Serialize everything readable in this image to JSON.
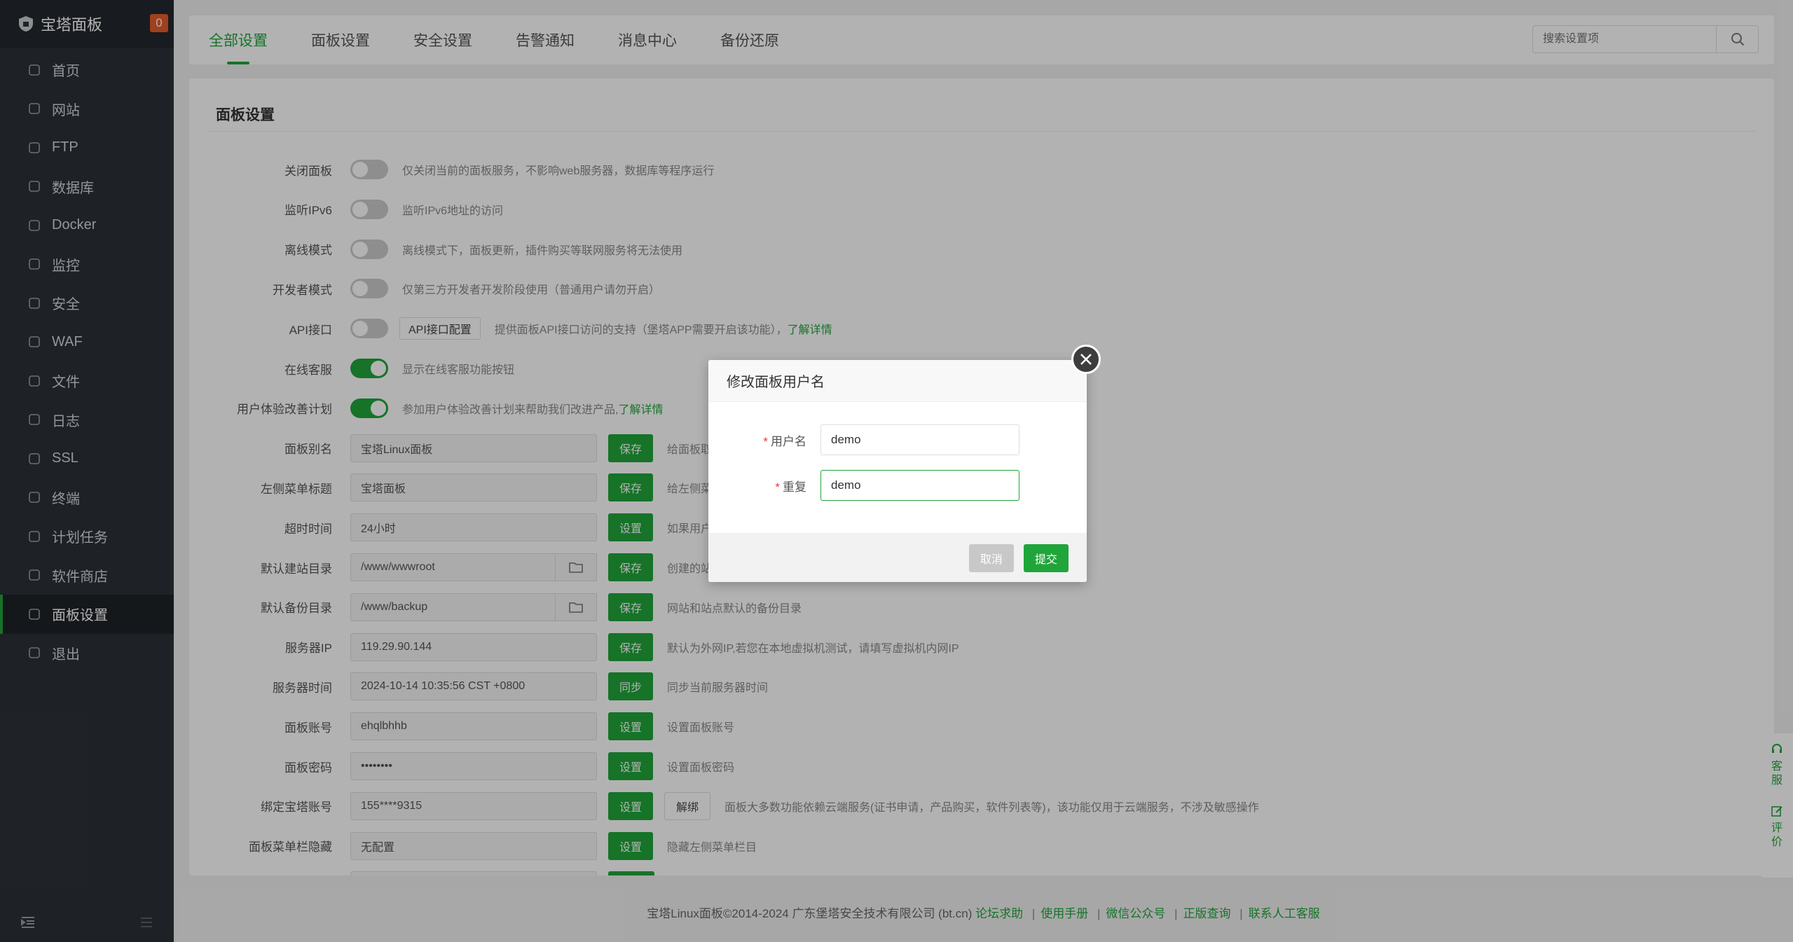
{
  "sidebar": {
    "brand": "宝塔面板",
    "badge": "0",
    "items": [
      {
        "label": "首页",
        "icon": "home-icon"
      },
      {
        "label": "网站",
        "icon": "globe-icon"
      },
      {
        "label": "FTP",
        "icon": "ftp-icon"
      },
      {
        "label": "数据库",
        "icon": "database-icon"
      },
      {
        "label": "Docker",
        "icon": "docker-icon"
      },
      {
        "label": "监控",
        "icon": "monitor-icon"
      },
      {
        "label": "安全",
        "icon": "shield-icon"
      },
      {
        "label": "WAF",
        "icon": "waf-shield-icon"
      },
      {
        "label": "文件",
        "icon": "folder-icon"
      },
      {
        "label": "日志",
        "icon": "log-icon"
      },
      {
        "label": "SSL",
        "icon": "ssl-icon"
      },
      {
        "label": "终端",
        "icon": "terminal-icon"
      },
      {
        "label": "计划任务",
        "icon": "cron-icon"
      },
      {
        "label": "软件商店",
        "icon": "store-icon"
      },
      {
        "label": "面板设置",
        "icon": "gear-icon"
      },
      {
        "label": "退出",
        "icon": "logout-icon"
      }
    ],
    "active_index": 14
  },
  "tabs": [
    "全部设置",
    "面板设置",
    "安全设置",
    "告警通知",
    "消息中心",
    "备份还原"
  ],
  "search": {
    "placeholder": "搜索设置项"
  },
  "panel": {
    "title": "面板设置",
    "toggles": [
      {
        "label": "关闭面板",
        "on": false,
        "desc": "仅关闭当前的面板服务，不影响web服务器，数据库等程序运行"
      },
      {
        "label": "监听IPv6",
        "on": false,
        "desc": "监听IPv6地址的访问"
      },
      {
        "label": "离线模式",
        "on": false,
        "desc": "离线模式下，面板更新，插件购买等联网服务将无法使用"
      },
      {
        "label": "开发者模式",
        "on": false,
        "desc": "仅第三方开发者开发阶段使用（普通用户请勿开启）"
      },
      {
        "label": "API接口",
        "on": false,
        "button": "API接口配置",
        "desc": "提供面板API接口访问的支持（堡塔APP需要开启该功能），",
        "link": "了解详情"
      },
      {
        "label": "在线客服",
        "on": true,
        "desc": "显示在线客服功能按钮"
      },
      {
        "label": "用户体验改善计划",
        "on": true,
        "desc": "参加用户体验改善计划来帮助我们改进产品,",
        "link": "了解详情"
      }
    ],
    "fields": [
      {
        "label": "面板别名",
        "value": "宝塔Linux面板",
        "btn": "保存",
        "desc": "给面板取"
      },
      {
        "label": "左侧菜单标题",
        "value": "宝塔面板",
        "btn": "保存",
        "desc": "给左侧菜"
      },
      {
        "label": "超时时间",
        "value": "24小时",
        "btn": "设置",
        "desc": "如果用户"
      },
      {
        "label": "默认建站目录",
        "value": "/www/wwwroot",
        "btn": "保存",
        "desc": "创建的站"
      },
      {
        "label": "默认备份目录",
        "value": "/www/backup",
        "btn": "保存",
        "desc": "网站和站点默认的备份目录"
      },
      {
        "label": "服务器IP",
        "value": "119.29.90.144",
        "btn": "保存",
        "desc": "默认为外网IP,若您在本地虚拟机测试，请填写虚拟机内网IP"
      },
      {
        "label": "服务器时间",
        "value": "2024-10-14 10:35:56 CST +0800",
        "btn": "同步",
        "desc": "同步当前服务器时间"
      },
      {
        "label": "面板账号",
        "value": "ehqlbhhb",
        "btn": "设置",
        "desc": "设置面板账号"
      },
      {
        "label": "面板密码",
        "value": "••••••••",
        "btn": "设置",
        "desc": "设置面板密码"
      },
      {
        "label": "绑定宝塔账号",
        "value": "155****9315",
        "btn": "设置",
        "btn2": "解绑",
        "desc": "面板大多数功能依赖云端服务(证书申请，产品购买，软件列表等)，该功能仅用于云端服务，不涉及敏感操作"
      },
      {
        "label": "面板菜单栏隐藏",
        "value": "无配置",
        "btn": "设置",
        "desc": "隐藏左侧菜单栏目"
      }
    ]
  },
  "modal": {
    "title": "修改面板用户名",
    "username_label": "用户名",
    "username_value": "demo",
    "repeat_label": "重复",
    "repeat_value": "demo",
    "cancel": "取消",
    "submit": "提交"
  },
  "footer": {
    "copyright": "宝塔Linux面板©2014-2024 广东堡塔安全技术有限公司 (bt.cn)",
    "links": [
      "论坛求助",
      "使用手册",
      "微信公众号",
      "正版查询",
      "联系人工客服"
    ]
  },
  "float": {
    "service": "客服",
    "review": "评价"
  }
}
